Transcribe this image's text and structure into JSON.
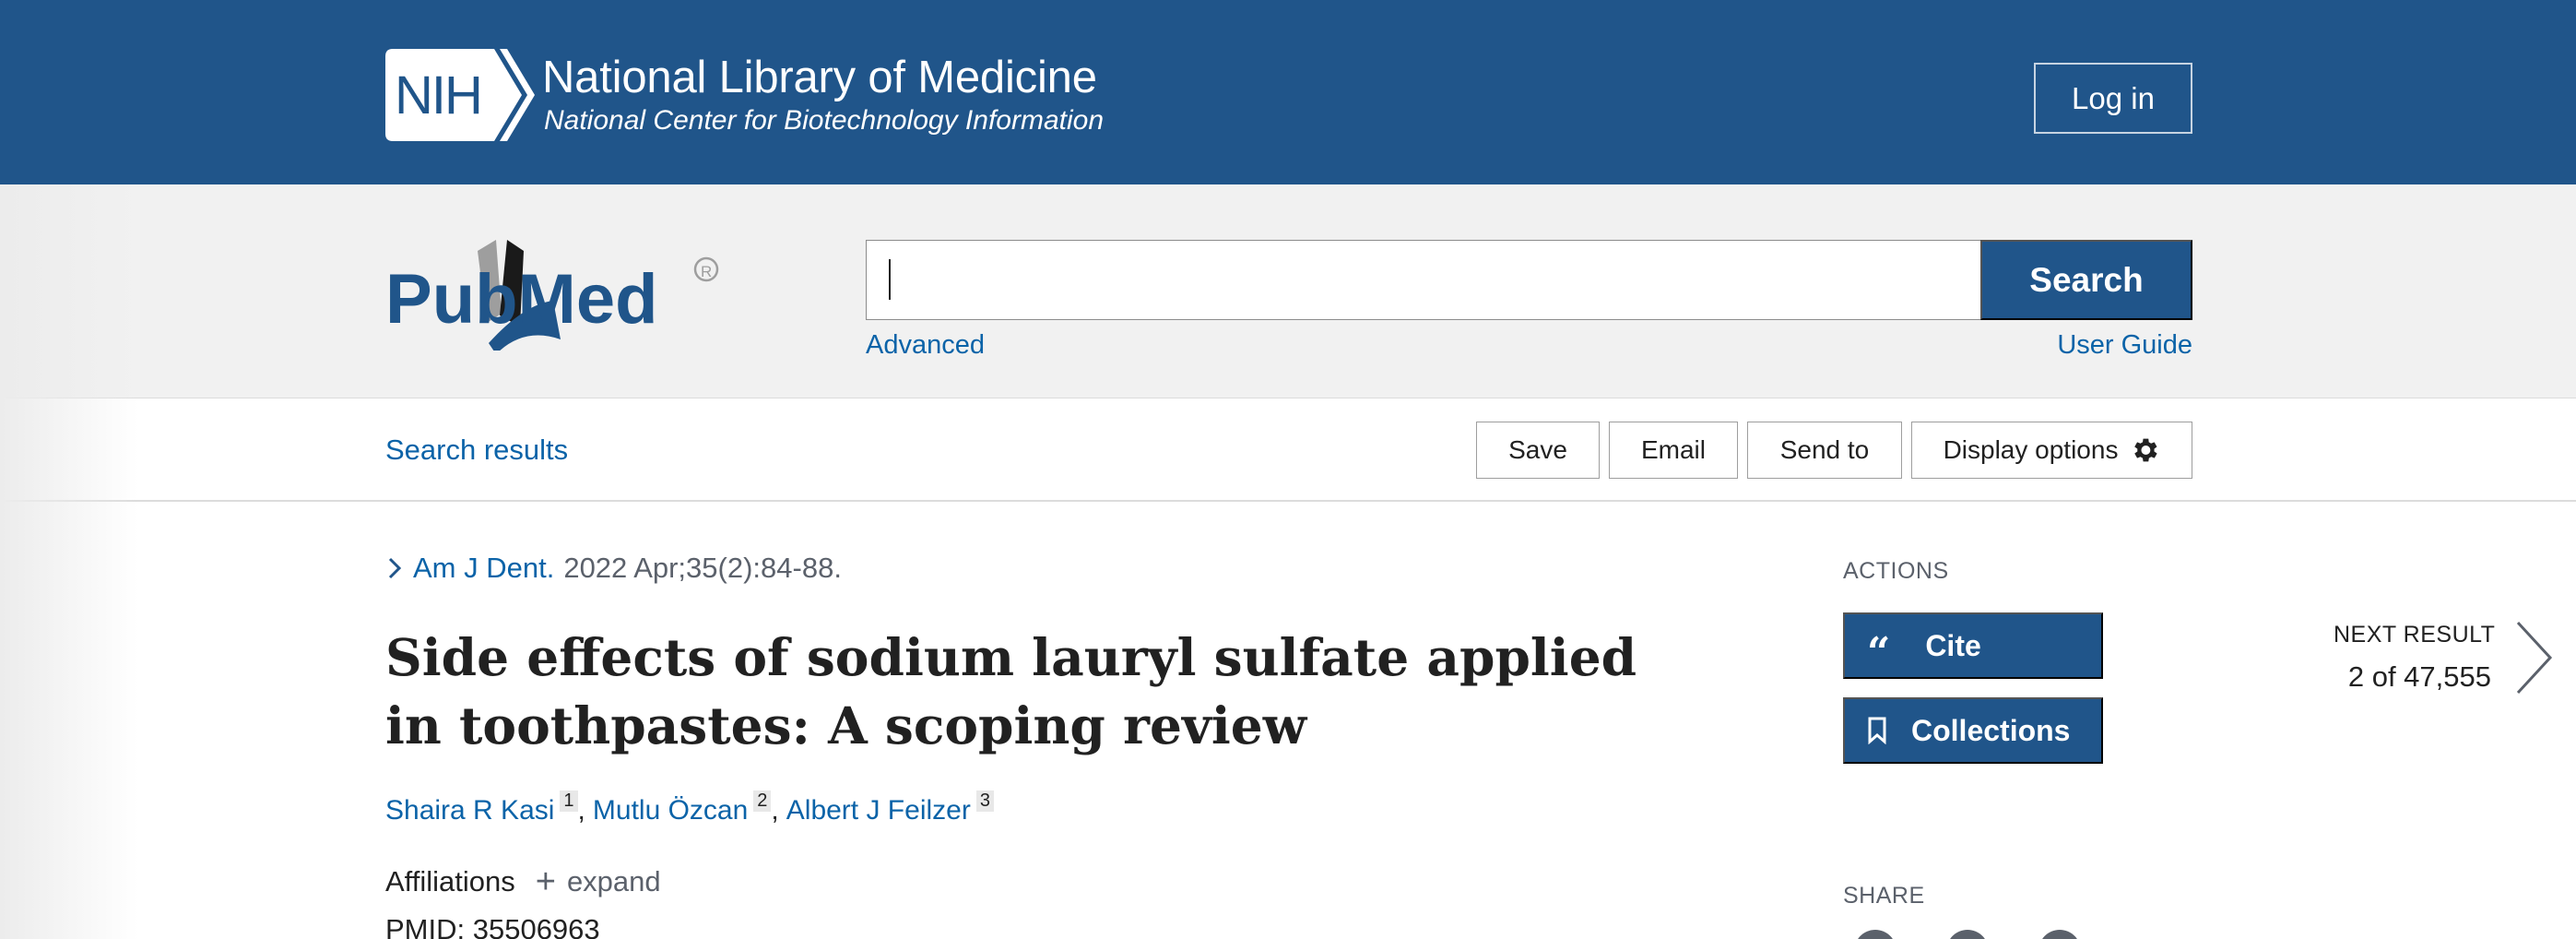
{
  "header": {
    "logo_text": "NIH",
    "title": "National Library of Medicine",
    "subtitle": "National Center for Biotechnology Information",
    "login_label": "Log in",
    "brand_color": "#20558a"
  },
  "search": {
    "logo_text": "PubMed",
    "value": "",
    "button_label": "Search",
    "advanced_label": "Advanced",
    "user_guide_label": "User Guide"
  },
  "toolbar": {
    "back_link": "Search results",
    "save_label": "Save",
    "email_label": "Email",
    "send_to_label": "Send to",
    "display_options_label": "Display options"
  },
  "article": {
    "journal": "Am J Dent.",
    "citation": "2022 Apr;35(2):84-88.",
    "title": "Side effects of sodium lauryl sulfate applied in toothpastes: A scoping review",
    "authors": [
      {
        "name": "Shaira R Kasi",
        "aff": "1"
      },
      {
        "name": "Mutlu Özcan",
        "aff": "2"
      },
      {
        "name": "Albert J Feilzer",
        "aff": "3"
      }
    ],
    "affiliations_label": "Affiliations",
    "expand_label": "expand",
    "pmid": "PMID: 35506963"
  },
  "sidebar": {
    "actions_heading": "ACTIONS",
    "cite_label": "Cite",
    "collections_label": "Collections",
    "share_heading": "SHARE"
  },
  "navigation": {
    "next_heading": "NEXT RESULT",
    "next_count": "2 of 47,555"
  },
  "icons": {
    "nih_logo": "nih-logo-icon",
    "pubmed_logo": "pubmed-logo-icon",
    "gear": "gear-icon",
    "chevron": "chevron-right-icon",
    "quote": "quote-icon",
    "bookmark": "bookmark-icon",
    "next": "chevron-right-large-icon",
    "plus": "plus-icon"
  }
}
